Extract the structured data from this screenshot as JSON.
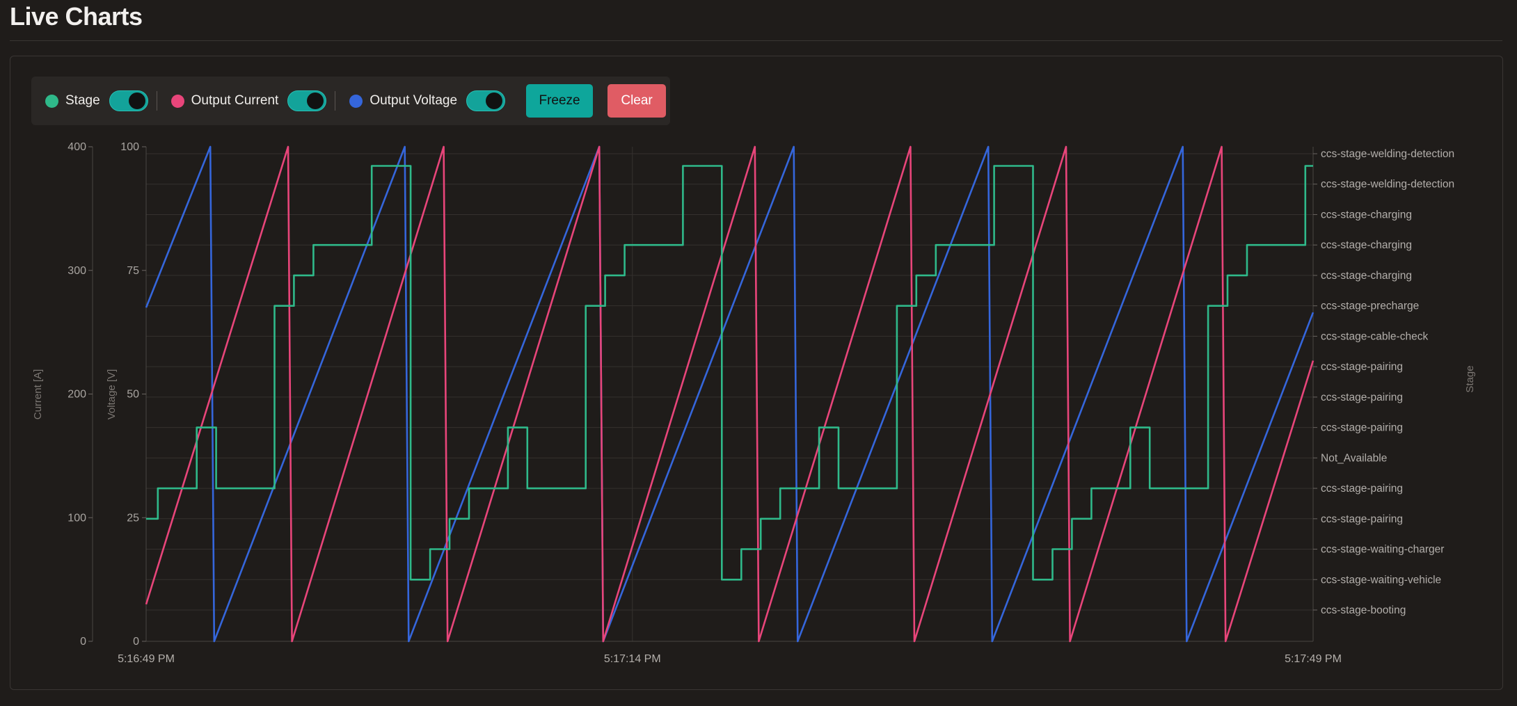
{
  "page": {
    "title": "Live Charts"
  },
  "controls": {
    "items": [
      {
        "label": "Stage",
        "color": "#2fb98a",
        "enabled": true
      },
      {
        "label": "Output Current",
        "color": "#e8457a",
        "enabled": true
      },
      {
        "label": "Output Voltage",
        "color": "#3566db",
        "enabled": true
      }
    ],
    "freeze_label": "Freeze",
    "clear_label": "Clear"
  },
  "chart_data": {
    "type": "line",
    "grid": true,
    "x_ticks": [
      "5:16:49 PM",
      "5:17:14 PM",
      "5:17:49 PM"
    ],
    "x_range": [
      "5:16:49 PM",
      "5:17:49 PM"
    ],
    "axes": {
      "current": {
        "label": "Current [A]",
        "range": [
          0,
          400
        ],
        "ticks": [
          0,
          100,
          200,
          300,
          400
        ]
      },
      "voltage": {
        "label": "Voltage [V]",
        "range": [
          0,
          100
        ],
        "ticks": [
          0,
          25,
          50,
          75,
          100
        ]
      },
      "stage": {
        "label": "Stage",
        "ticks": [
          "ccs-stage-booting",
          "ccs-stage-waiting-vehicle",
          "ccs-stage-waiting-charger",
          "ccs-stage-pairing",
          "ccs-stage-pairing",
          "Not_Available",
          "ccs-stage-pairing",
          "ccs-stage-pairing",
          "ccs-stage-pairing",
          "ccs-stage-cable-check",
          "ccs-stage-precharge",
          "ccs-stage-charging",
          "ccs-stage-charging",
          "ccs-stage-charging",
          "ccs-stage-welding-detection",
          "ccs-stage-welding-detection"
        ]
      }
    },
    "series": [
      {
        "name": "Output Voltage",
        "axis": "voltage",
        "color": "#3566db",
        "points": [
          [
            0,
            67.5
          ],
          [
            3.3,
            100
          ],
          [
            3.5,
            0
          ],
          [
            13.3,
            100
          ],
          [
            13.5,
            0
          ],
          [
            23.3,
            100
          ],
          [
            23.5,
            0
          ],
          [
            33.3,
            100
          ],
          [
            33.5,
            0
          ],
          [
            43.3,
            100
          ],
          [
            43.5,
            0
          ],
          [
            53.3,
            100
          ],
          [
            53.5,
            0
          ],
          [
            60,
            66.5
          ]
        ]
      },
      {
        "name": "Output Current",
        "axis": "current",
        "color": "#e8457a",
        "points": [
          [
            0,
            30
          ],
          [
            7.3,
            400
          ],
          [
            7.5,
            0
          ],
          [
            15.3,
            400
          ],
          [
            15.5,
            0
          ],
          [
            23.3,
            400
          ],
          [
            23.5,
            0
          ],
          [
            31.3,
            400
          ],
          [
            31.5,
            0
          ],
          [
            39.3,
            400
          ],
          [
            39.5,
            0
          ],
          [
            47.3,
            400
          ],
          [
            47.5,
            0
          ],
          [
            55.3,
            400
          ],
          [
            55.5,
            0
          ],
          [
            60,
            227
          ]
        ]
      },
      {
        "name": "Stage",
        "axis": "stage",
        "color": "#2fb98a",
        "points": [
          [
            0,
            3
          ],
          [
            0.6,
            3
          ],
          [
            0.6,
            4
          ],
          [
            2.6,
            4
          ],
          [
            2.6,
            6
          ],
          [
            3.6,
            6
          ],
          [
            3.6,
            4
          ],
          [
            6.6,
            4
          ],
          [
            6.6,
            10
          ],
          [
            7.6,
            10
          ],
          [
            7.6,
            11
          ],
          [
            8.6,
            11
          ],
          [
            8.6,
            12
          ],
          [
            11.6,
            12
          ],
          [
            11.6,
            14.6
          ],
          [
            13.6,
            14.6
          ],
          [
            13.6,
            1
          ],
          [
            14.6,
            1
          ],
          [
            14.6,
            2
          ],
          [
            15.6,
            2
          ],
          [
            15.6,
            3
          ],
          [
            16.6,
            3
          ],
          [
            16.6,
            4
          ],
          [
            18.6,
            4
          ],
          [
            18.6,
            6
          ],
          [
            19.6,
            6
          ],
          [
            19.6,
            4
          ],
          [
            22.6,
            4
          ],
          [
            22.6,
            10
          ],
          [
            23.6,
            10
          ],
          [
            23.6,
            11
          ],
          [
            24.6,
            11
          ],
          [
            24.6,
            12
          ],
          [
            27.6,
            12
          ],
          [
            27.6,
            14.6
          ],
          [
            29.6,
            14.6
          ],
          [
            29.6,
            1
          ],
          [
            30.6,
            1
          ],
          [
            30.6,
            2
          ],
          [
            31.6,
            2
          ],
          [
            31.6,
            3
          ],
          [
            32.6,
            3
          ],
          [
            32.6,
            4
          ],
          [
            34.6,
            4
          ],
          [
            34.6,
            6
          ],
          [
            35.6,
            6
          ],
          [
            35.6,
            4
          ],
          [
            38.6,
            4
          ],
          [
            38.6,
            10
          ],
          [
            39.6,
            10
          ],
          [
            39.6,
            11
          ],
          [
            40.6,
            11
          ],
          [
            40.6,
            12
          ],
          [
            43.6,
            12
          ],
          [
            43.6,
            14.6
          ],
          [
            45.6,
            14.6
          ],
          [
            45.6,
            1
          ],
          [
            46.6,
            1
          ],
          [
            46.6,
            2
          ],
          [
            47.6,
            2
          ],
          [
            47.6,
            3
          ],
          [
            48.6,
            3
          ],
          [
            48.6,
            4
          ],
          [
            50.6,
            4
          ],
          [
            50.6,
            6
          ],
          [
            51.6,
            6
          ],
          [
            51.6,
            4
          ],
          [
            54.6,
            4
          ],
          [
            54.6,
            10
          ],
          [
            55.6,
            10
          ],
          [
            55.6,
            11
          ],
          [
            56.6,
            11
          ],
          [
            56.6,
            12
          ],
          [
            59.6,
            12
          ],
          [
            59.6,
            14.6
          ],
          [
            60,
            14.6
          ]
        ]
      }
    ]
  }
}
